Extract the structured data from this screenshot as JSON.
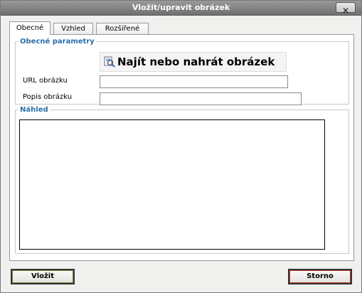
{
  "window": {
    "title": "Vložit/upravit obrázek",
    "close_symbol": "✕"
  },
  "tabs": [
    {
      "label": "Obecné",
      "active": true
    },
    {
      "label": "Vzhled",
      "active": false
    },
    {
      "label": "Rozšířené",
      "active": false
    }
  ],
  "general": {
    "legend": "Obecné parametry",
    "browse_label": "Najít nebo nahrát obrázek ...",
    "browse_icon": "magnifier-image-icon",
    "url_label": "URL obrázku",
    "url_value": "",
    "desc_label": "Popis obrázku",
    "desc_value": ""
  },
  "preview": {
    "legend": "Náhled"
  },
  "buttons": {
    "insert": "Vložit",
    "cancel": "Storno"
  }
}
